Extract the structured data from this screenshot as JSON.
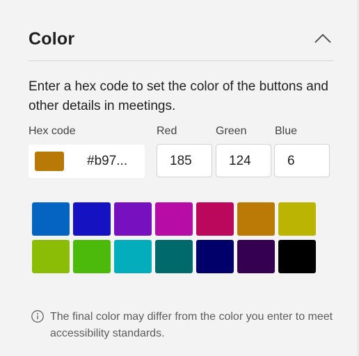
{
  "section": {
    "title": "Color",
    "collapse_icon": "chevron-up-icon",
    "description": "Enter a hex code to set the color of the buttons and other details in meetings."
  },
  "hex": {
    "label": "Hex code",
    "value": "#b97...",
    "swatch_color": "#b97906"
  },
  "rgb": {
    "red_label": "Red",
    "green_label": "Green",
    "blue_label": "Blue",
    "red_value": "185",
    "green_value": "124",
    "blue_value": "6"
  },
  "palette": [
    "#0563c1",
    "#1512c1",
    "#7711bf",
    "#b80ca6",
    "#bb075c",
    "#bb7a06",
    "#bbb402",
    "#8bbd07",
    "#4bba0a",
    "#04adbb",
    "#00696c",
    "#01006b",
    "#34004f",
    "#000000"
  ],
  "info": {
    "icon": "info-icon",
    "text": "The final color may differ from the color you enter to meet accessibility standards."
  }
}
